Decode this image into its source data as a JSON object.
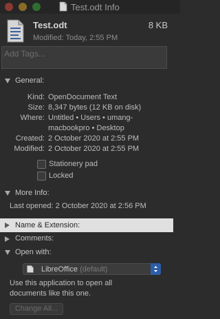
{
  "window": {
    "title": "Test.odt Info"
  },
  "file": {
    "name": "Test.odt",
    "size": "8 KB",
    "modified": "Modified: Today, 2:55 PM"
  },
  "tags": {
    "placeholder": "Add Tags..."
  },
  "general": {
    "heading": "General:",
    "kind_label": "Kind:",
    "kind": "OpenDocument Text",
    "size_label": "Size:",
    "size": "8,347 bytes (12 KB on disk)",
    "where_label": "Where:",
    "where_line1": "Untitled • Users • umang-",
    "where_line2": "macbookpro • Desktop",
    "created_label": "Created:",
    "created": "2 October 2020 at 2:55 PM",
    "modified_label": "Modified:",
    "modified": "2 October 2020 at 2:55 PM",
    "stationery_label": "Stationery pad",
    "locked_label": "Locked"
  },
  "more_info": {
    "heading": "More Info:",
    "last_opened": "Last opened: 2 October 2020 at 2:56 PM"
  },
  "name_extension": {
    "heading": "Name & Extension:"
  },
  "comments": {
    "heading": "Comments:"
  },
  "open_with": {
    "heading": "Open with:",
    "app": "LibreOffice",
    "app_default": "(default)",
    "description": "Use this application to open all documents like this one.",
    "change_all": "Change All..."
  }
}
